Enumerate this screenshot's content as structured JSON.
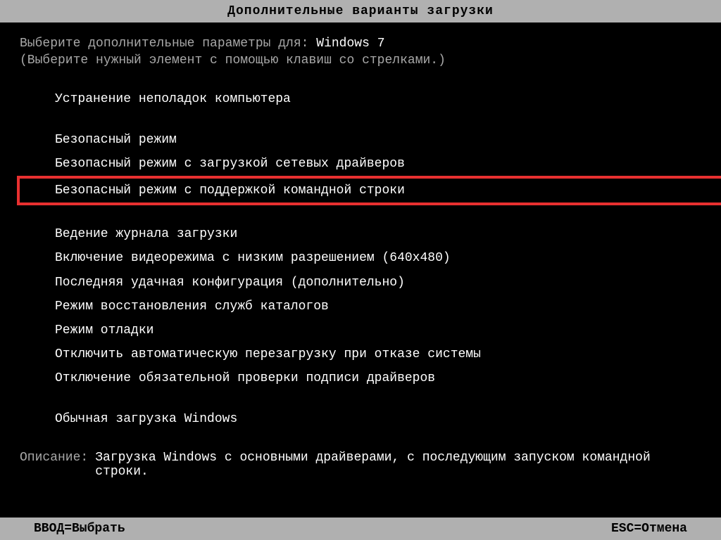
{
  "title": "Дополнительные варианты загрузки",
  "prompt_label": "Выберите дополнительные параметры для: ",
  "os_name": "Windows 7",
  "instruction": "(Выберите нужный элемент с помощью клавиш со стрелками.)",
  "menu": {
    "group1": [
      "Устранение неполадок компьютера"
    ],
    "group2": [
      "Безопасный режим",
      "Безопасный режим с загрузкой сетевых драйверов",
      "Безопасный режим с поддержкой командной строки"
    ],
    "group3": [
      "Ведение журнала загрузки",
      "Включение видеорежима с низким разрешением (640x480)",
      "Последняя удачная конфигурация (дополнительно)",
      "Режим восстановления служб каталогов",
      "Режим отладки",
      "Отключить автоматическую перезагрузку при отказе системы",
      "Отключение обязательной проверки подписи драйверов"
    ],
    "group4": [
      "Обычная загрузка Windows"
    ]
  },
  "description": {
    "label": "Описание:",
    "text": "Загрузка Windows с основными драйверами, с последующим запуском командной строки."
  },
  "footer": {
    "select": "ВВОД=Выбрать",
    "cancel": "ESC=Отмена"
  }
}
